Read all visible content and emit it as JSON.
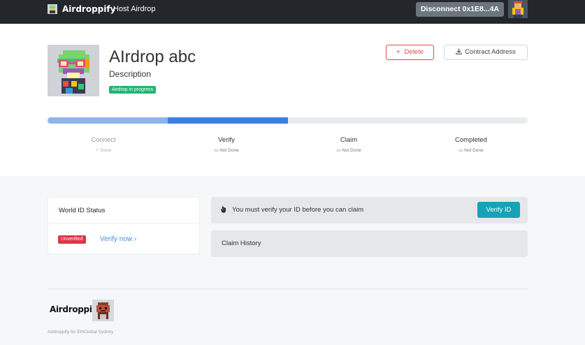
{
  "nav": {
    "brand": "Airdroppify",
    "host_link": "Host Airdrop",
    "disconnect_label": "Disconnect 0x1E8...4A"
  },
  "airdrop": {
    "title": "AIrdrop abc",
    "description": "Description",
    "status_badge": "Airdrop in progress",
    "delete_label": "Delete",
    "contract_label": "Contract Address"
  },
  "progress": {
    "completed_fraction": 0.5,
    "steps": [
      {
        "name": "Connect",
        "status": "Done",
        "icon": "check-icon",
        "state": "done"
      },
      {
        "name": "Verify",
        "status": "Not Done",
        "icon": "calendar-icon",
        "state": "pending"
      },
      {
        "name": "Claim",
        "status": "Not Done",
        "icon": "calendar-icon",
        "state": "pending"
      },
      {
        "name": "Completed",
        "status": "Not Done",
        "icon": "calendar-icon",
        "state": "pending"
      }
    ]
  },
  "world_id": {
    "title": "World ID Status",
    "status": "Unverified",
    "verify_link": "Verify now ›"
  },
  "claim": {
    "alert_message": "You must verify your ID before you can claim",
    "verify_button": "Verify ID",
    "history_title": "Claim History"
  },
  "footer": {
    "brand": "Airdroppify",
    "note": "Airdroppify for EthGlobal Sydney"
  },
  "colors": {
    "navbar": "#23262b",
    "progress_light": "#8fb3ea",
    "progress_dark": "#3d7fe0",
    "delete": "#e24c4b",
    "badge_green": "#22b573",
    "verify_button": "#17a2b8",
    "unverified": "#dc3545"
  }
}
